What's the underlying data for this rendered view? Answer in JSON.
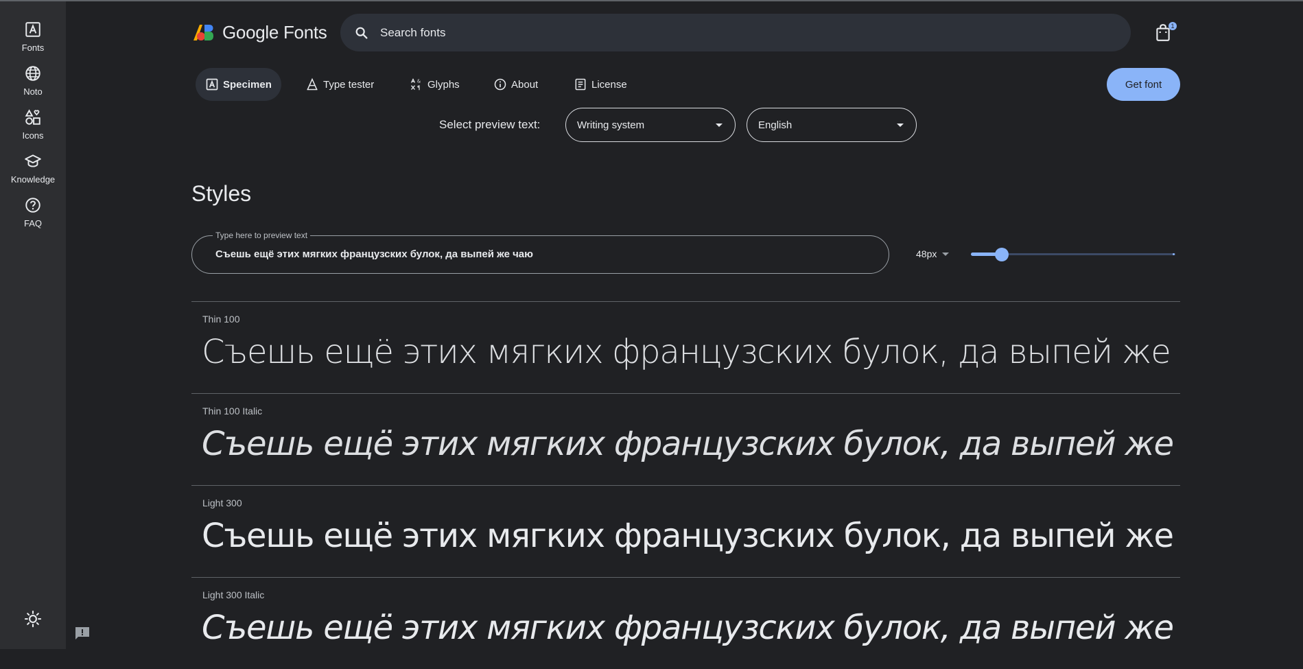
{
  "rail": {
    "items": [
      {
        "label": "Fonts"
      },
      {
        "label": "Noto"
      },
      {
        "label": "Icons"
      },
      {
        "label": "Knowledge"
      },
      {
        "label": "FAQ"
      }
    ]
  },
  "header": {
    "logo_text": "Google Fonts",
    "search_placeholder": "Search fonts",
    "cart_count": "1"
  },
  "tabs": [
    {
      "label": "Specimen",
      "active": true
    },
    {
      "label": "Type tester"
    },
    {
      "label": "Glyphs"
    },
    {
      "label": "About"
    },
    {
      "label": "License"
    }
  ],
  "get_font_label": "Get font",
  "preview": {
    "label": "Select preview text:",
    "writing_system": "Writing system",
    "language": "English"
  },
  "styles": {
    "title": "Styles",
    "field_legend": "Type here to preview text",
    "field_value": "Съешь ещё этих мягких французских булок, да выпей же чаю",
    "size_value": "48px",
    "size_slider_fraction": 0.15
  },
  "style_rows": [
    {
      "name": "Thin 100",
      "sample": "Съешь ещё этих мягких французских булок, да выпей же чаю"
    },
    {
      "name": "Thin 100 Italic",
      "sample": "Съешь ещё этих мягких французских булок, да выпей же чаю"
    },
    {
      "name": "Light 300",
      "sample": "Съешь ещё этих мягких французских булок, да выпей же чаю"
    },
    {
      "name": "Light 300 Italic",
      "sample": "Съешь ещё этих мягких французских булок, да выпей же чаю"
    }
  ],
  "colors": {
    "background": "#202124",
    "rail": "#2d2e31",
    "accent": "#8ab4f8"
  }
}
